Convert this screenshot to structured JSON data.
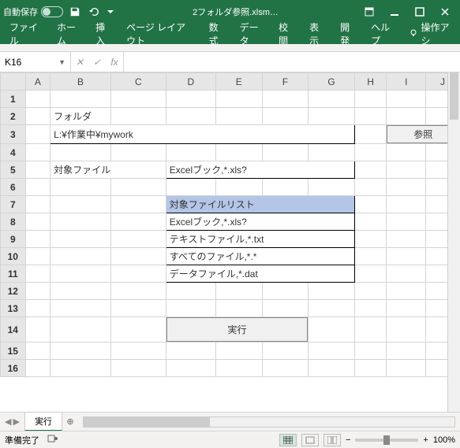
{
  "titlebar": {
    "autosave_label": "自動保存",
    "autosave_off": "オフ",
    "filename": "2フォルダ参照.xlsm…"
  },
  "ribbon": {
    "tabs": [
      "ファイル",
      "ホーム",
      "挿入",
      "ページ レイアウト",
      "数式",
      "データ",
      "校閲",
      "表示",
      "開発",
      "ヘルプ"
    ],
    "tellme": "操作アシ"
  },
  "formula_bar": {
    "namebox": "K16",
    "value": ""
  },
  "columns": [
    "A",
    "B",
    "C",
    "D",
    "E",
    "F",
    "G",
    "H",
    "I",
    "J"
  ],
  "sheet": {
    "r2": {
      "b": "フォルダ"
    },
    "r3": {
      "path": "L:¥作業中¥mywork",
      "btn": "参照"
    },
    "r5": {
      "b": "対象ファイル",
      "val": "Excelブック,*.xls?"
    },
    "r7": {
      "hdr": "対象ファイルリスト"
    },
    "r8": {
      "val": "Excelブック,*.xls?"
    },
    "r9": {
      "val": "テキストファイル,*.txt"
    },
    "r10": {
      "val": "すべてのファイル,*.*"
    },
    "r11": {
      "val": "データファイル,*.dat"
    },
    "r14": {
      "btn": "実行"
    }
  },
  "sheet_tabs": {
    "active": "実行"
  },
  "statusbar": {
    "ready": "準備完了",
    "zoom": "100%"
  }
}
